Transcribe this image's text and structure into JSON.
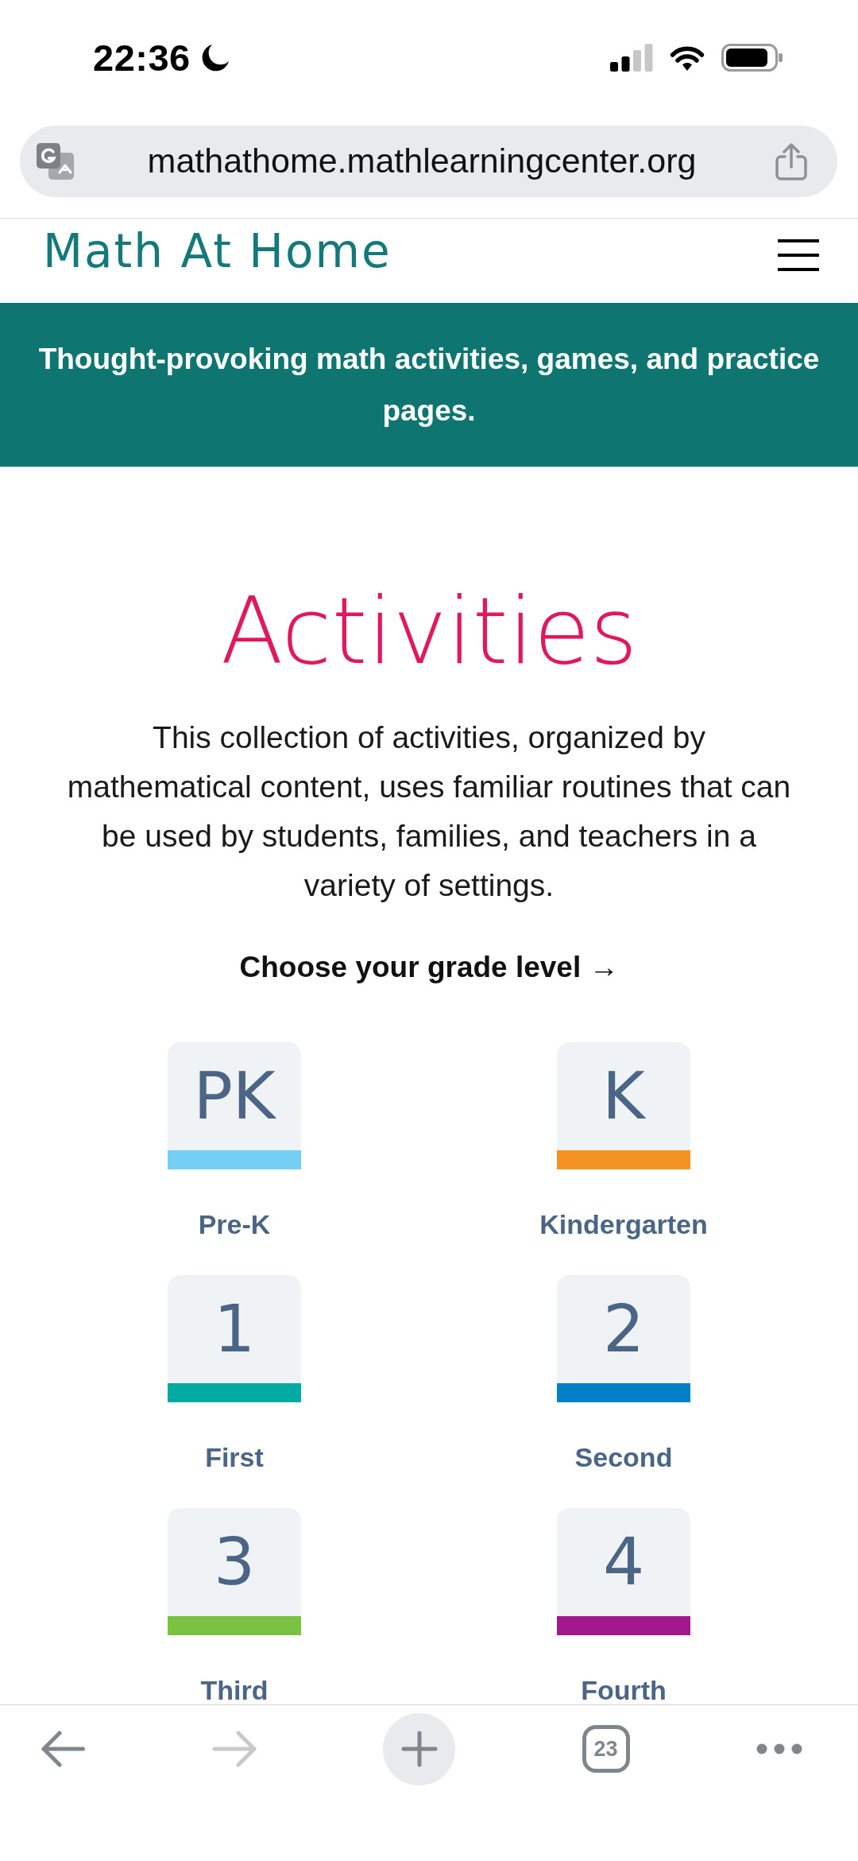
{
  "status_bar": {
    "time": "22:36"
  },
  "browser": {
    "url": "mathathome.mathlearningcenter.org"
  },
  "site_header": {
    "title": "Math At Home"
  },
  "banner": {
    "text": "Thought-provoking math activities, games, and practice pages."
  },
  "main": {
    "heading": "Activities",
    "intro": "This collection of activities, organized by mathematical content, uses familiar routines that can be used by students, families, and teachers in a variety of settings.",
    "prompt": "Choose your grade level →"
  },
  "grades": [
    {
      "badge": "PK",
      "label": "Pre-K",
      "color": "#74cff5"
    },
    {
      "badge": "K",
      "label": "Kindergarten",
      "color": "#f49322"
    },
    {
      "badge": "1",
      "label": "First",
      "color": "#00aba3"
    },
    {
      "badge": "2",
      "label": "Second",
      "color": "#0080c7"
    },
    {
      "badge": "3",
      "label": "Third",
      "color": "#7bc142"
    },
    {
      "badge": "4",
      "label": "Fourth",
      "color": "#a3198d"
    }
  ],
  "toolbar": {
    "buttons": [
      {
        "kind": "back",
        "disabled": false
      },
      {
        "kind": "forward",
        "disabled": true
      },
      {
        "kind": "new_tab",
        "disabled": false
      },
      {
        "kind": "tabs",
        "label": "23",
        "disabled": false
      },
      {
        "kind": "more",
        "disabled": false
      }
    ]
  }
}
